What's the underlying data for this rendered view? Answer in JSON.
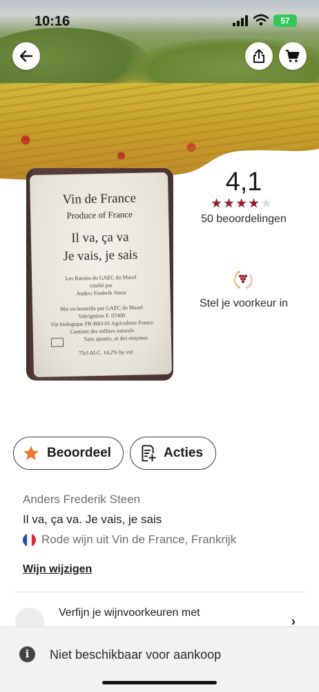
{
  "status_bar": {
    "time": "10:16",
    "battery": "57"
  },
  "rating": {
    "score": "4,1",
    "stars_filled": 4,
    "stars_total": 5,
    "count_label": "50 beoordelingen"
  },
  "preference": {
    "label": "Stel je voorkeur in"
  },
  "bottle_label": {
    "line1": "Vin de France",
    "line2": "Produce of France",
    "line3": "Il va, ça va",
    "line4": "Je vais, je sais",
    "small1": "Les Raisins du GAEC du Mazel",
    "small2": "vinifié par",
    "small3": "Anders Frederik Steen",
    "small4": "Mis en bouteille par GAEC du Mazel",
    "small5": "Valvignères F. 07400",
    "small6": "Vin biologique FR-BIO-01 Agriculture France",
    "small7": "Contient des sulfites naturels",
    "small8": "Sans ajoutés, ni des enzymes",
    "bottom": "75cl ALC. 14,2% by vol"
  },
  "actions": {
    "rate_label": "Beoordeel",
    "actions_label": "Acties"
  },
  "wine": {
    "producer": "Anders Frederik Steen",
    "name": "Il va, ça va. Je vais, je sais",
    "region": "Rode wijn uit Vin de France, Frankrijk",
    "edit_link": "Wijn wijzigen"
  },
  "refine": {
    "text": "Verfijn je wijnvoorkeuren met"
  },
  "availability": {
    "message": "Niet beschikbaar voor aankoop"
  },
  "colors": {
    "star": "#8e1f2b",
    "star_empty": "#dddddd",
    "rate_star": "#e8772e"
  }
}
